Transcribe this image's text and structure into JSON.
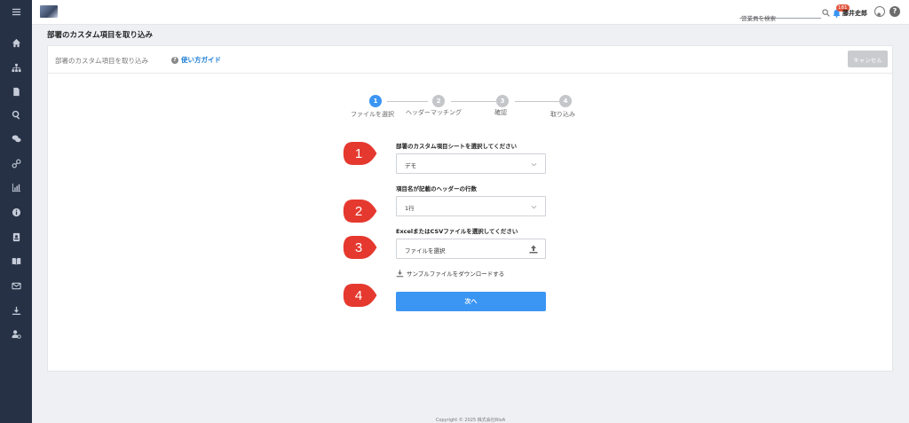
{
  "sidebar": {
    "icons": [
      "menu-icon",
      "home-icon",
      "org-chart-icon",
      "document-icon",
      "search-icon",
      "chat-icon",
      "link-icon",
      "bar-chart-icon",
      "info-icon",
      "contact-card-icon",
      "book-icon",
      "mail-icon",
      "download-icon",
      "user-settings-icon"
    ]
  },
  "topbar": {
    "search_placeholder": "営業員を検索",
    "notification_count": "181",
    "user_name": "藤井史郎",
    "help_glyph": "?"
  },
  "page": {
    "title": "部署のカスタム項目を取り込み",
    "breadcrumb": "部署のカスタム項目を取り込み",
    "guide_label": "使い方ガイド",
    "cancel_label": "キャンセル"
  },
  "steps": [
    {
      "num": "1",
      "label": "ファイルを選択",
      "active": true
    },
    {
      "num": "2",
      "label": "ヘッダーマッチング",
      "active": false
    },
    {
      "num": "3",
      "label": "確認",
      "active": false
    },
    {
      "num": "4",
      "label": "取り込み",
      "active": false
    }
  ],
  "form": {
    "sheet_label": "部署のカスタム項目シートを選択してください",
    "sheet_value": "デモ",
    "header_rows_label": "項目名が記載のヘッダーの行数",
    "header_rows_value": "1行",
    "file_label": "ExcelまたはCSVファイルを選択してください",
    "file_value": "ファイルを選択",
    "sample_link": "サンプルファイルをダウンロードする",
    "next_label": "次へ"
  },
  "callouts": [
    "1",
    "2",
    "3",
    "4"
  ],
  "colors": {
    "sidebar": "#263146",
    "accent": "#3a95f3",
    "callout_red": "#e5392f",
    "step_inactive": "#c4c6ca"
  },
  "footer": {
    "copyright": "Copyright © 2025 株式会社RIoA"
  }
}
